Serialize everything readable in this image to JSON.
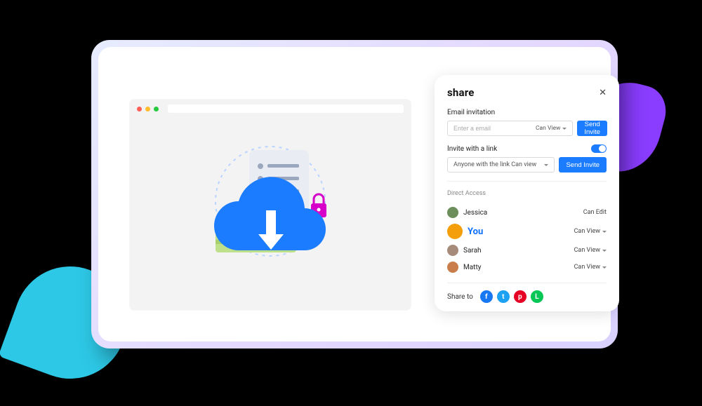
{
  "share": {
    "title": "share",
    "email_section_label": "Email invitation",
    "email_placeholder": "Enter a email",
    "email_perm": "Can View",
    "send_invite_label": "Send Invite",
    "link_section_label": "Invite with a link",
    "link_perm_text": "Anyone with the link Can view",
    "link_toggle_on": true,
    "direct_access_label": "Direct Access",
    "members": [
      {
        "name": "Jessica",
        "perm": "Can Edit",
        "has_dropdown": false,
        "is_you": false,
        "avatar_color": "#6b8e5a"
      },
      {
        "name": "You",
        "perm": "Can View",
        "has_dropdown": true,
        "is_you": true,
        "avatar_color": "#f59e0b"
      },
      {
        "name": "Sarah",
        "perm": "Can View",
        "has_dropdown": true,
        "is_you": false,
        "avatar_color": "#a78b7a"
      },
      {
        "name": "Matty",
        "perm": "Can View",
        "has_dropdown": true,
        "is_you": false,
        "avatar_color": "#c97d4a"
      }
    ],
    "share_to_label": "Share to",
    "socials": [
      {
        "name": "facebook-icon",
        "class": "fb",
        "glyph": "f"
      },
      {
        "name": "twitter-icon",
        "class": "tw",
        "glyph": "t"
      },
      {
        "name": "pinterest-icon",
        "class": "pn",
        "glyph": "p"
      },
      {
        "name": "line-icon",
        "class": "ln",
        "glyph": "L"
      }
    ]
  }
}
